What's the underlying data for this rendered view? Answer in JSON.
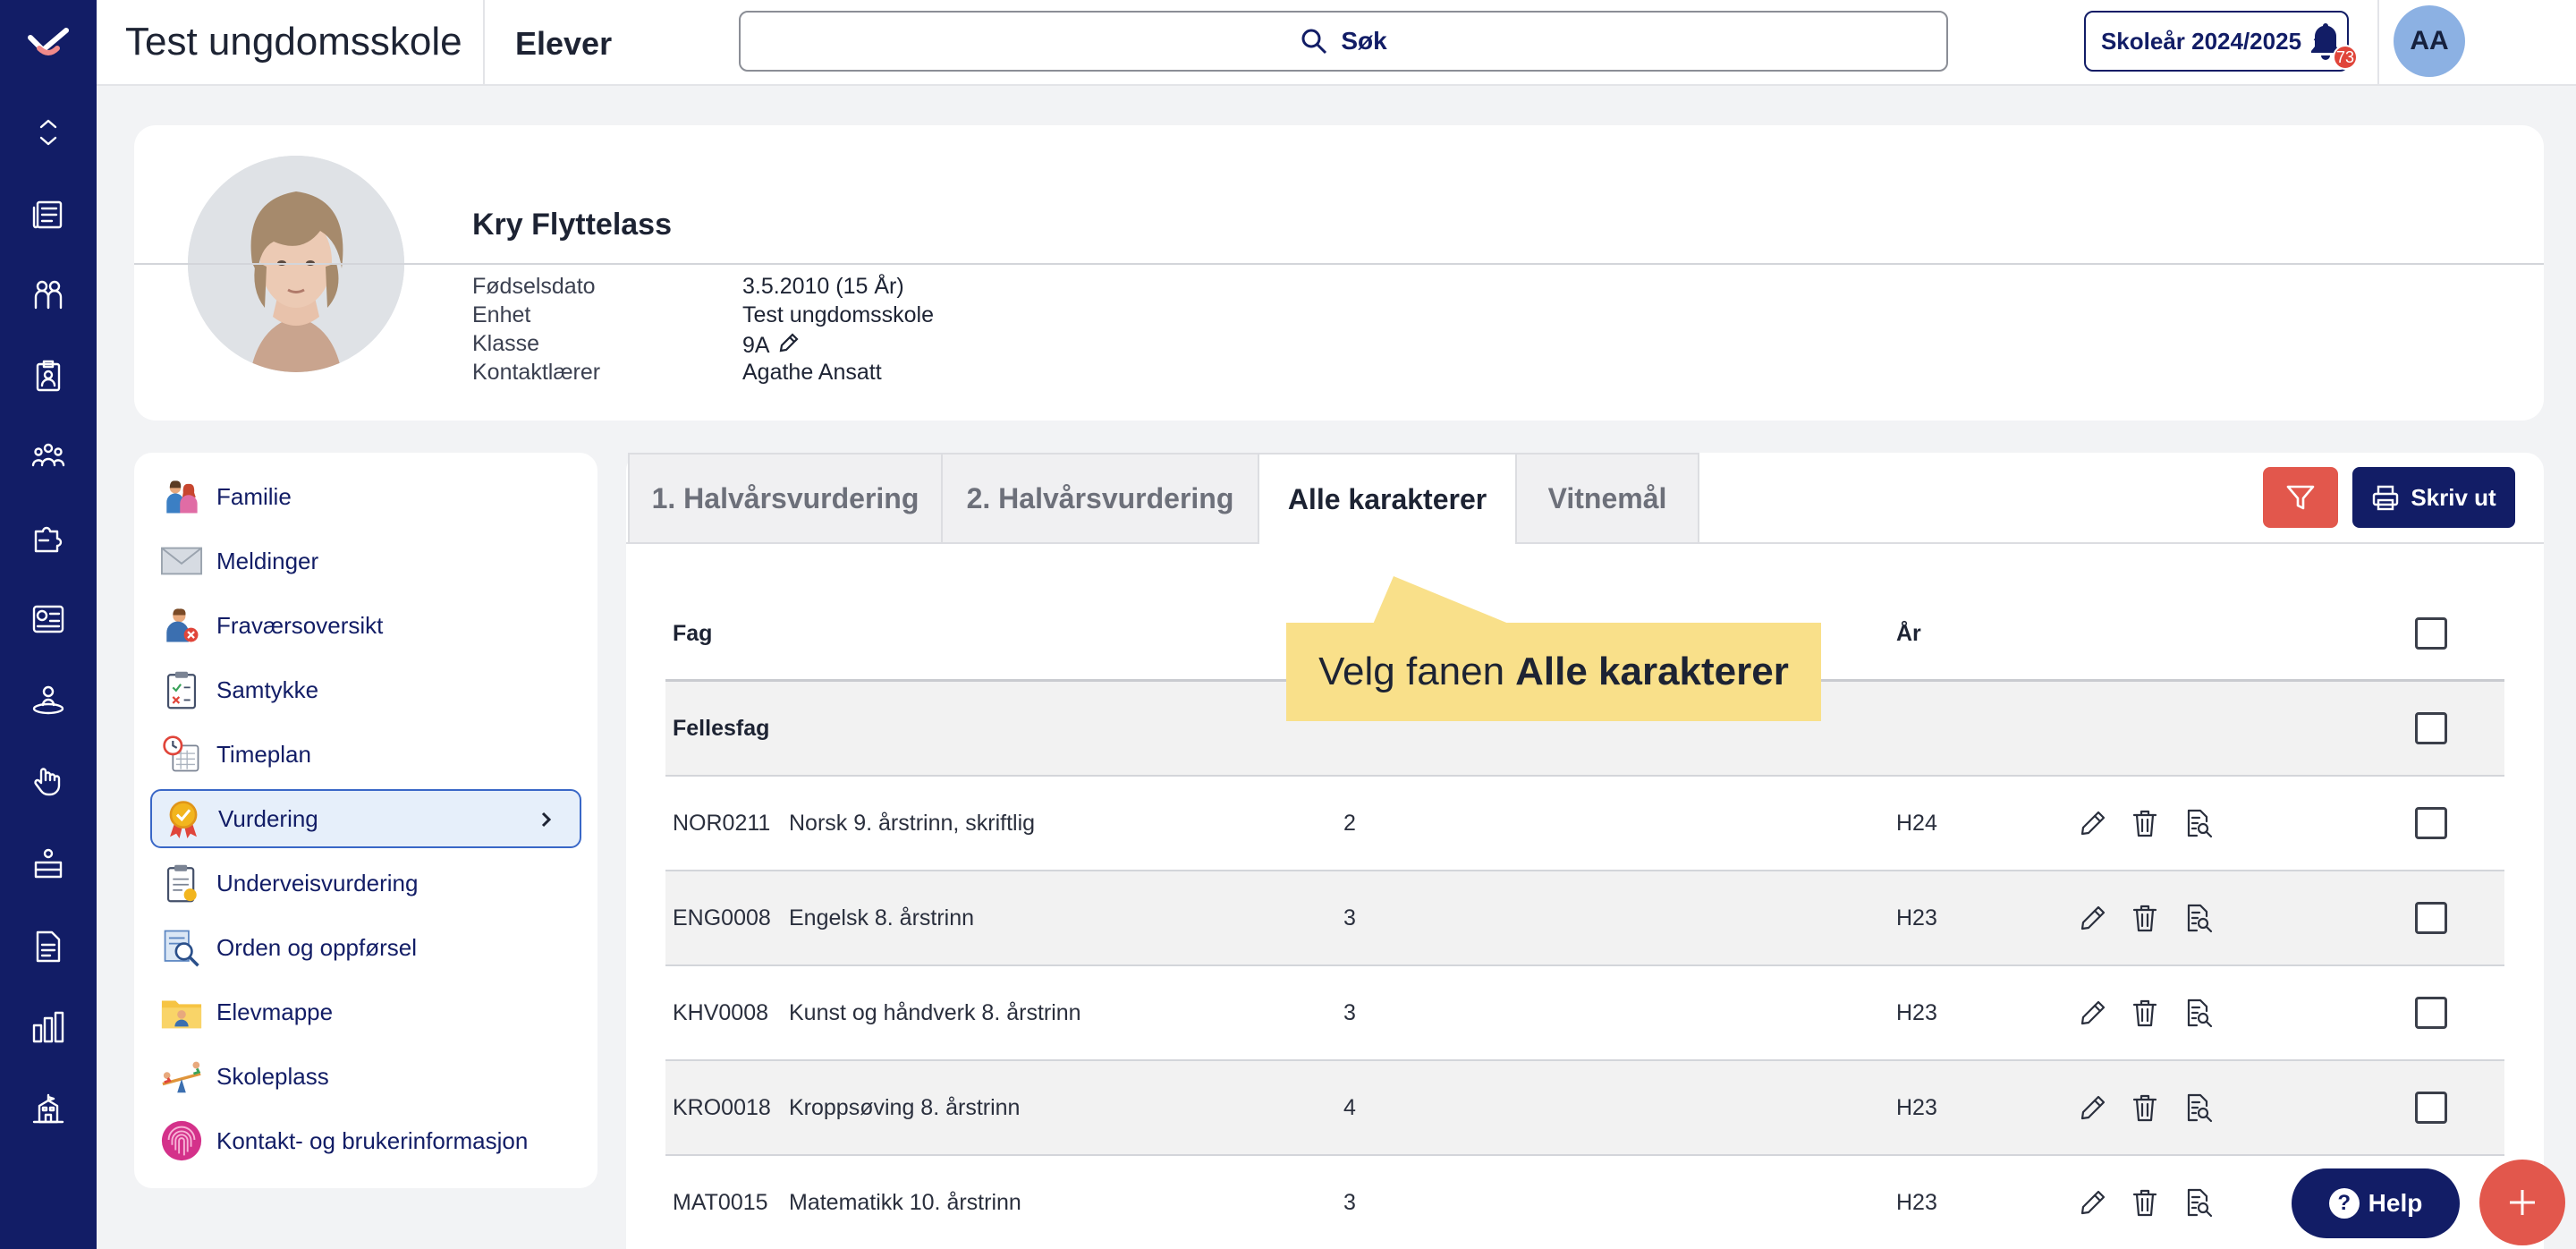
{
  "header": {
    "school_name": "Test ungdomsskole",
    "section": "Elever",
    "search_label": "Søk",
    "school_year": "Skoleår 2024/2025",
    "notification_count": "73",
    "user_initials": "AA"
  },
  "student": {
    "name": "Kry Flyttelass",
    "fields": [
      {
        "label": "Fødselsdato",
        "value": "3.5.2010 (15 År)"
      },
      {
        "label": "Enhet",
        "value": "Test ungdomsskole"
      },
      {
        "label": "Klasse",
        "value": "9A"
      },
      {
        "label": "Kontaktlærer",
        "value": "Agathe Ansatt"
      }
    ]
  },
  "menu": {
    "items": [
      {
        "label": "Familie",
        "icon": "family-icon"
      },
      {
        "label": "Meldinger",
        "icon": "envelope-icon"
      },
      {
        "label": "Fraværsoversikt",
        "icon": "absence-icon"
      },
      {
        "label": "Samtykke",
        "icon": "clipboard-consent-icon"
      },
      {
        "label": "Timeplan",
        "icon": "calendar-clock-icon"
      },
      {
        "label": "Vurdering",
        "icon": "medal-icon",
        "active": true
      },
      {
        "label": "Underveisvurdering",
        "icon": "clipboard-assessment-icon"
      },
      {
        "label": "Orden og oppførsel",
        "icon": "document-search-icon"
      },
      {
        "label": "Elevmappe",
        "icon": "folder-icon"
      },
      {
        "label": "Skoleplass",
        "icon": "seesaw-icon"
      },
      {
        "label": "Kontakt- og brukerinformasjon",
        "icon": "fingerprint-icon"
      }
    ]
  },
  "tabs": [
    {
      "label": "1. Halvårsvurdering"
    },
    {
      "label": "2. Halvårsvurdering"
    },
    {
      "label": "Alle karakterer",
      "active": true
    },
    {
      "label": "Vitnemål"
    }
  ],
  "toolbar": {
    "print_label": "Skriv ut"
  },
  "table": {
    "col_subject": "Fag",
    "col_year": "År",
    "group": "Fellesfag",
    "rows": [
      {
        "code": "NOR0211",
        "name": "Norsk 9. årstrinn, skriftlig",
        "grade": "2",
        "year": "H24"
      },
      {
        "code": "ENG0008",
        "name": "Engelsk 8. årstrinn",
        "grade": "3",
        "year": "H23"
      },
      {
        "code": "KHV0008",
        "name": "Kunst og håndverk 8. årstrinn",
        "grade": "3",
        "year": "H23"
      },
      {
        "code": "KRO0018",
        "name": "Kroppsøving 8. årstrinn",
        "grade": "4",
        "year": "H23"
      },
      {
        "code": "MAT0015",
        "name": "Matematikk 10. årstrinn",
        "grade": "3",
        "year": "H23"
      }
    ]
  },
  "tooltip": {
    "prefix": "Velg fanen",
    "emphasis": "Alle karakterer"
  },
  "help": {
    "label": "Help",
    "q": "?"
  },
  "colors": {
    "navy": "#121d66",
    "accent_red": "#e2574c",
    "tooltip": "#f9e08a"
  }
}
